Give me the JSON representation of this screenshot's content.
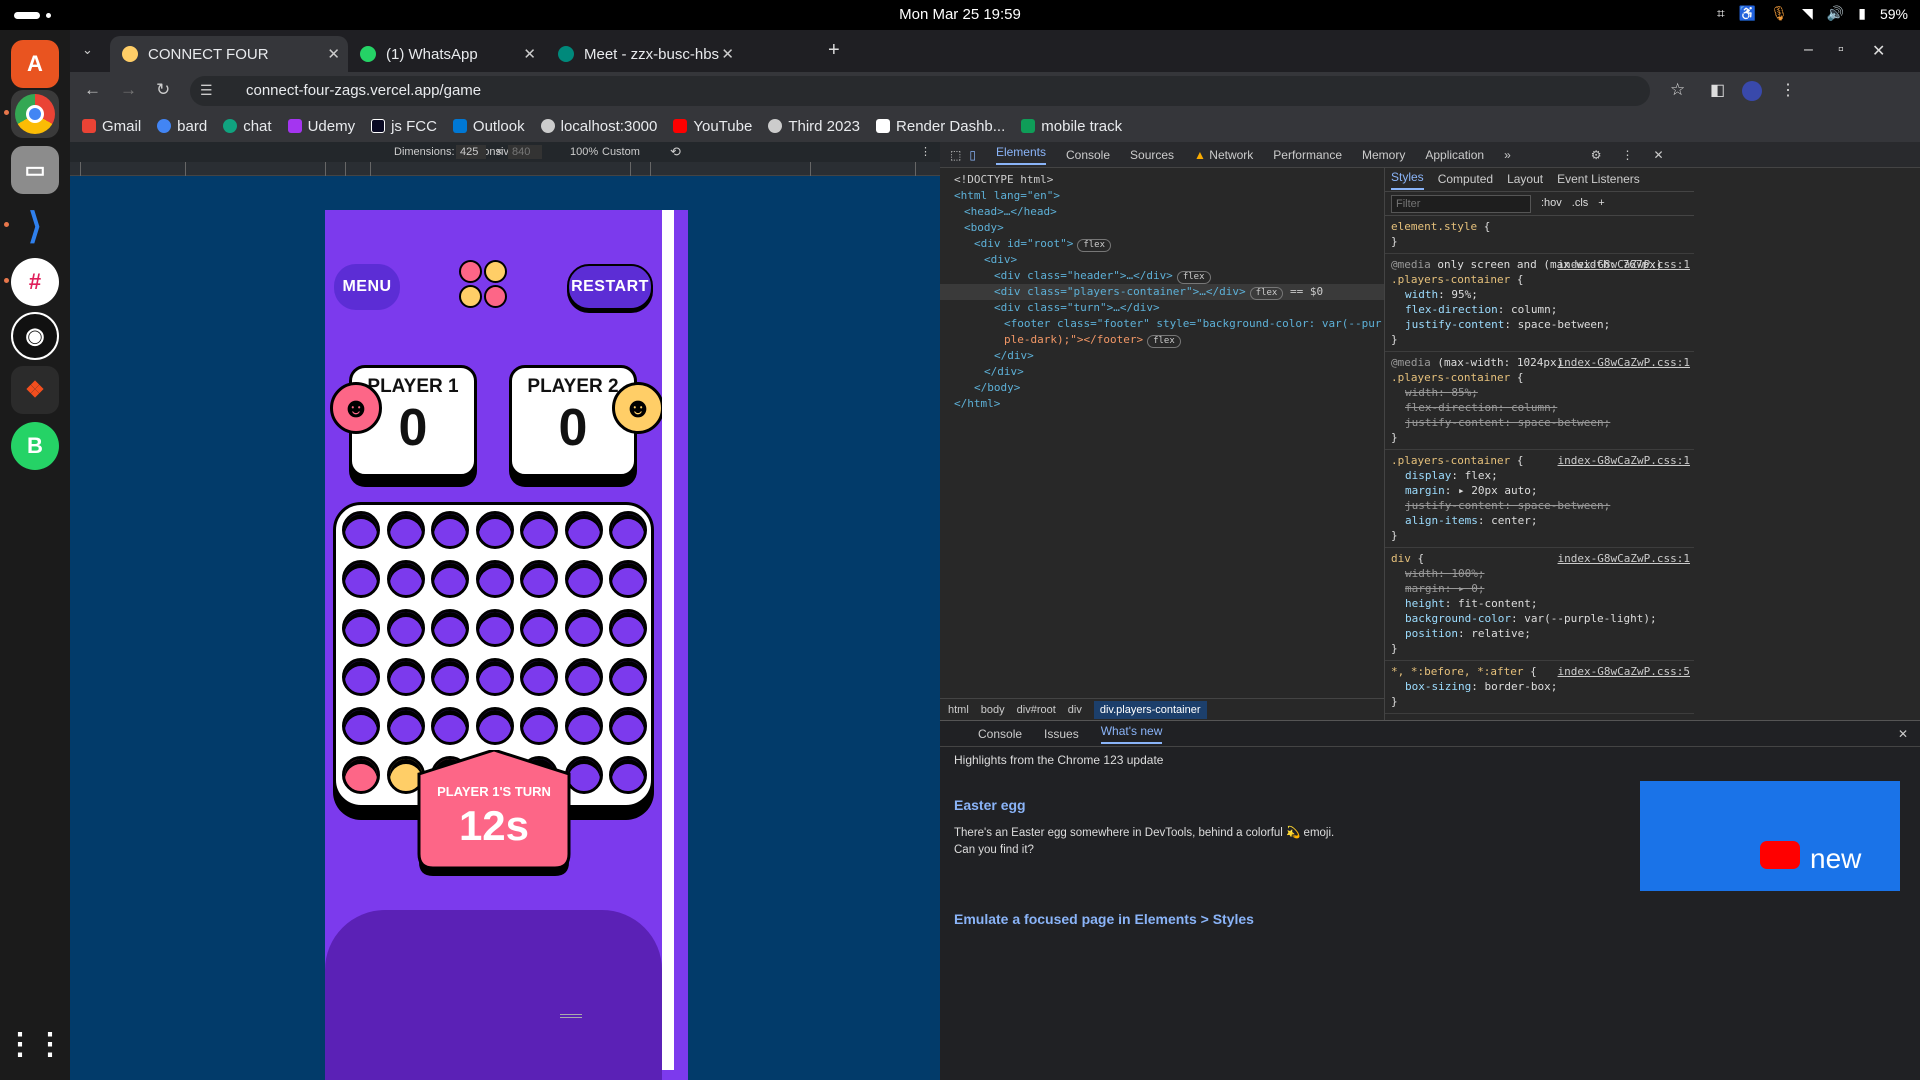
{
  "system": {
    "clock": "Mon Mar 25  19:59",
    "battery": "59%"
  },
  "dock": [
    {
      "name": "app-center"
    },
    {
      "name": "chrome"
    },
    {
      "name": "files"
    },
    {
      "name": "vscode"
    },
    {
      "name": "slack"
    },
    {
      "name": "github"
    },
    {
      "name": "figma"
    },
    {
      "name": "whatsapp"
    }
  ],
  "tabs": [
    {
      "title": "CONNECT FOUR"
    },
    {
      "title": "(1) WhatsApp"
    },
    {
      "title": "Meet - zzx-busc-hbs"
    }
  ],
  "url": "connect-four-zags.vercel.app/game",
  "bookmarks": [
    "Gmail",
    "bard",
    "chat",
    "Udemy",
    "js FCC",
    "Outlook",
    "localhost:3000",
    "YouTube",
    "Third 2023",
    "Render Dashb...",
    "mobile track"
  ],
  "device_toolbar": {
    "dimensions": "Dimensions: Responsive",
    "width": "425",
    "height": "840",
    "zoom": "100%",
    "throttle": "Custom"
  },
  "game": {
    "menu": "MENU",
    "restart": "RESTART",
    "p1": {
      "name": "PLAYER 1",
      "score": "0"
    },
    "p2": {
      "name": "PLAYER 2",
      "score": "0"
    },
    "turn": "PLAYER 1'S TURN",
    "seconds": "12s",
    "bottom_row": [
      "red",
      "yellow",
      "red",
      "empty",
      "empty",
      "empty",
      "empty"
    ],
    "colors": {
      "purple": "#7c3aed",
      "red": "#fd6687",
      "yellow": "#ffce67"
    }
  },
  "devtools": {
    "tabs": [
      "Elements",
      "Console",
      "Sources",
      "Network",
      "Performance",
      "Memory",
      "Application"
    ],
    "dom": [
      "<!DOCTYPE html>",
      "<html lang=\"en\">",
      "<head>…</head>",
      "<body>",
      "<div id=\"root\">",
      "<div>",
      "<div class=\"header\">…</div>",
      "<div class=\"players-container\">…</div>",
      "<div class=\"turn\">…</div>",
      "<footer class=\"footer\" style=\"background-color: var(--pur",
      "ple-dark);\"></footer>",
      "</div>",
      "</div>",
      "</body>",
      "</html>"
    ],
    "crumbs": [
      "html",
      "body",
      "div#root",
      "div",
      "div.players-container"
    ],
    "style_tabs": [
      "Styles",
      "Computed",
      "Layout",
      "Event Listeners"
    ],
    "filter": "Filter",
    "drawer_tabs": [
      "Console",
      "Issues",
      "What's new"
    ],
    "highlights": "Highlights from the Chrome 123 update",
    "egg_title": "Easter egg",
    "egg_text": "There's an Easter egg somewhere in DevTools, behind a colorful 💫 emoji. Can you find it?",
    "emulate": "Emulate a focused page in Elements > Styles",
    "new": "new"
  }
}
